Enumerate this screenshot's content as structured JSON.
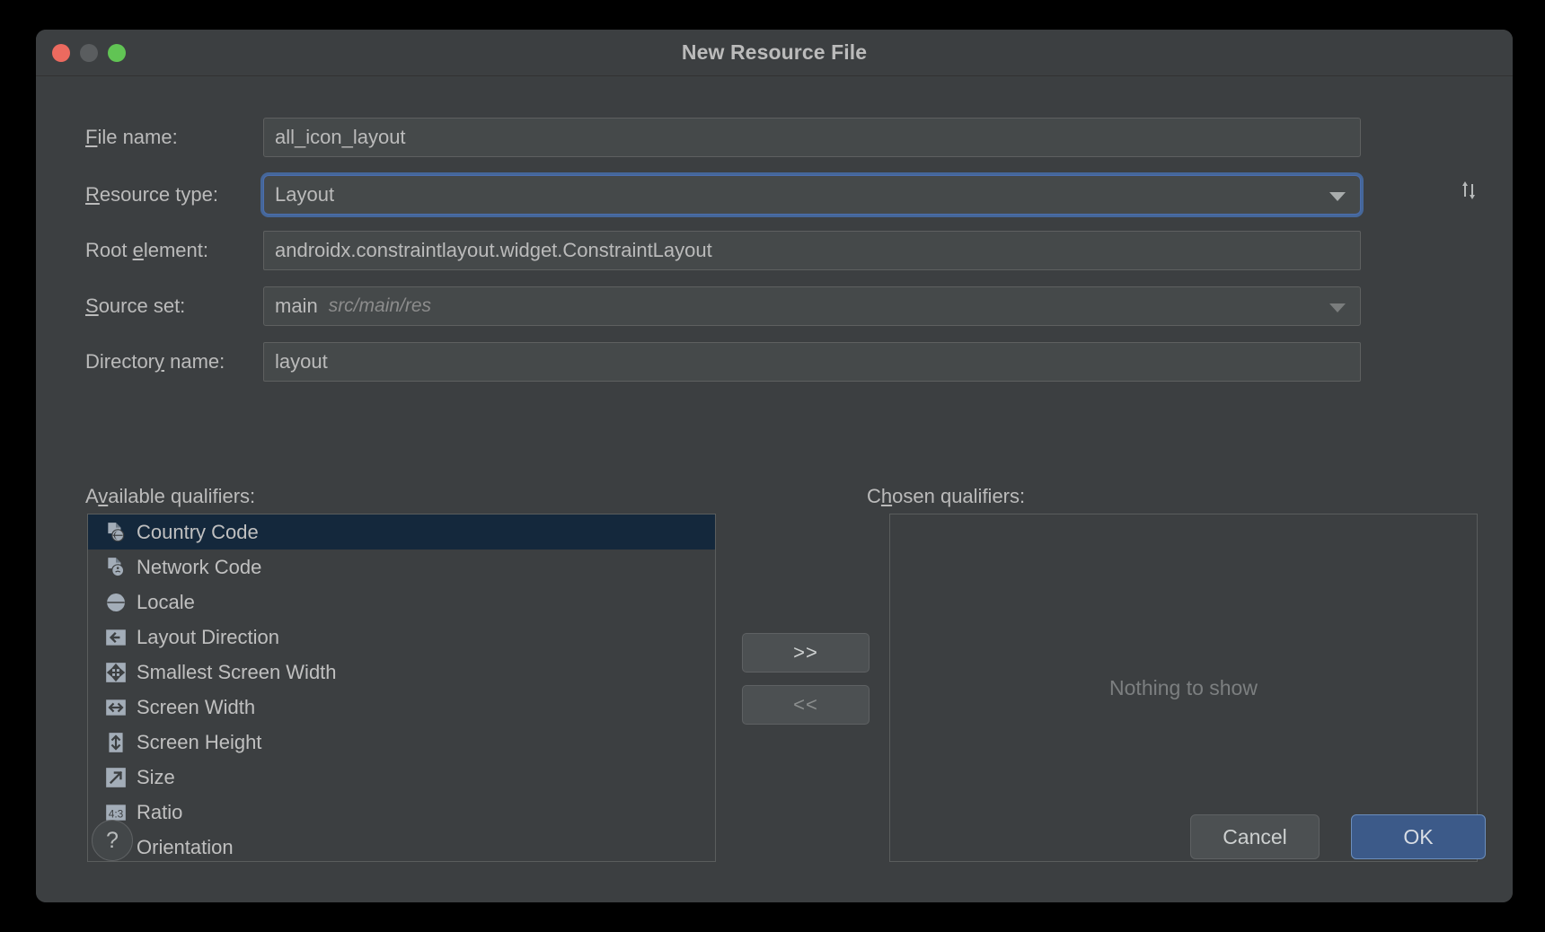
{
  "window": {
    "title": "New Resource File",
    "traffic_lights": [
      "close",
      "minimize",
      "maximize"
    ],
    "colors": {
      "close": "#ec6a5f",
      "minimize": "#5a5d5f",
      "maximize": "#61c454",
      "dialog_bg": "#3c3f41",
      "field_bg": "#45494a",
      "focus_ring": "#4b6eaf",
      "selection_bg": "#14283c",
      "ok_button_bg": "#3c5a89",
      "text": "#bbbbbb",
      "muted_text": "#8c8c8c"
    }
  },
  "form": {
    "file_name": {
      "label_pre": "",
      "label_mnemonic": "F",
      "label_post": "ile name:",
      "value": "all_icon_layout"
    },
    "resource_type": {
      "label_pre": "",
      "label_mnemonic": "R",
      "label_post": "esource type:",
      "value": "Layout"
    },
    "root_element": {
      "label_pre": "Root ",
      "label_mnemonic": "e",
      "label_post": "lement:",
      "value": "androidx.constraintlayout.widget.ConstraintLayout"
    },
    "source_set": {
      "label_pre": "",
      "label_mnemonic": "S",
      "label_post": "ource set:",
      "value": "main",
      "value_path": "src/main/res"
    },
    "directory_name": {
      "label_pre": "Director",
      "label_mnemonic": "y",
      "label_post": " name:",
      "value": "layout"
    },
    "sort_icon": "sort-up-down-icon"
  },
  "qualifiers": {
    "available_label_pre": "A",
    "available_label_mnemonic": "v",
    "available_label_post": "ailable qualifiers:",
    "chosen_label_pre": "C",
    "chosen_label_mnemonic": "h",
    "chosen_label_post": "osen qualifiers:",
    "available": [
      {
        "label": "Country Code",
        "icon": "file-globe-icon",
        "selected": true
      },
      {
        "label": "Network Code",
        "icon": "file-network-icon",
        "selected": false
      },
      {
        "label": "Locale",
        "icon": "globe-icon",
        "selected": false
      },
      {
        "label": "Layout Direction",
        "icon": "arrow-left-icon",
        "selected": false
      },
      {
        "label": "Smallest Screen Width",
        "icon": "four-way-arrows-icon",
        "selected": false
      },
      {
        "label": "Screen Width",
        "icon": "arrows-horizontal-icon",
        "selected": false
      },
      {
        "label": "Screen Height",
        "icon": "arrows-vertical-icon",
        "selected": false
      },
      {
        "label": "Size",
        "icon": "diagonal-arrow-icon",
        "selected": false
      },
      {
        "label": "Ratio",
        "icon": "ratio-43-icon",
        "selected": false
      },
      {
        "label": "Orientation",
        "icon": "orientation-icon",
        "selected": false
      }
    ],
    "add_button": ">>",
    "remove_button": "<<",
    "chosen_empty_text": "Nothing to show"
  },
  "footer": {
    "help_label": "?",
    "cancel_label": "Cancel",
    "ok_label": "OK"
  }
}
